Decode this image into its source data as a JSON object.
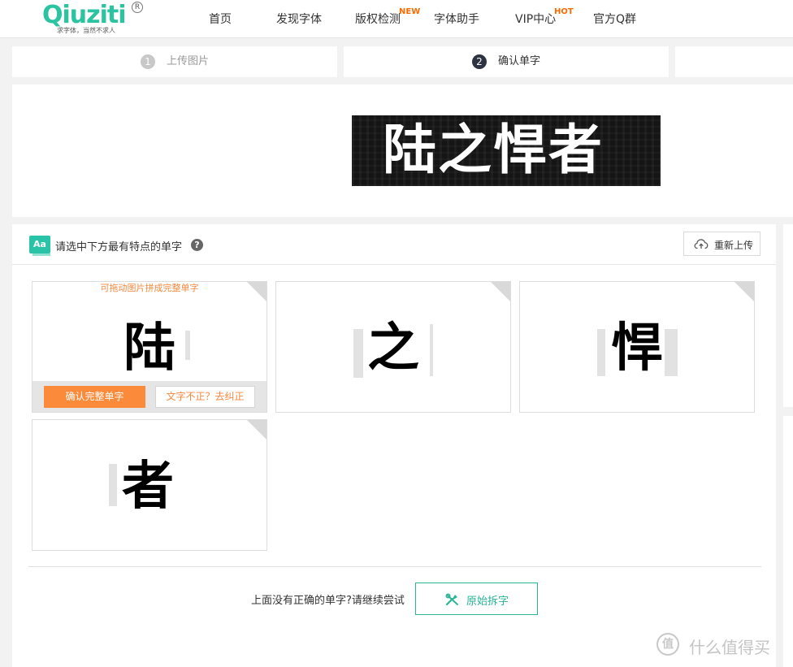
{
  "logo": {
    "wordmark": "Qiuziti",
    "registered": "R",
    "slogan": "求字体，当然不求人"
  },
  "nav": {
    "items": [
      {
        "label": "首页"
      },
      {
        "label": "发现字体"
      },
      {
        "label": "版权检测",
        "badge": "NEW"
      },
      {
        "label": "字体助手"
      },
      {
        "label": "VIP中心",
        "badge": "HOT"
      },
      {
        "label": "官方Q群"
      }
    ]
  },
  "steps": [
    {
      "number": "1",
      "label": "上传图片",
      "state": "done"
    },
    {
      "number": "2",
      "label": "确认单字",
      "state": "active"
    }
  ],
  "preview": {
    "text": "陆之悍者"
  },
  "panel": {
    "icon_label": "Aa",
    "title": "请选中下方最有特点的单字",
    "help": "?",
    "reupload_label": "重新上传"
  },
  "cards": [
    {
      "char": "陆",
      "hint": "可拖动图片拼成完整单字",
      "confirm_label": "确认完整单字",
      "fix_label": "文字不正？去纠正"
    },
    {
      "char": "之"
    },
    {
      "char": "悍"
    },
    {
      "char": "者"
    }
  ],
  "footer": {
    "prompt": "上面没有正确的单字?请继续尝试",
    "split_label": "原始拆字"
  },
  "watermark": {
    "symbol": "值",
    "text": "什么值得买"
  },
  "colors": {
    "brand": "#2bc3a0",
    "accent_orange": "#fb8a3b",
    "badge": "#ff6a00",
    "step_active": "#2d3340"
  }
}
